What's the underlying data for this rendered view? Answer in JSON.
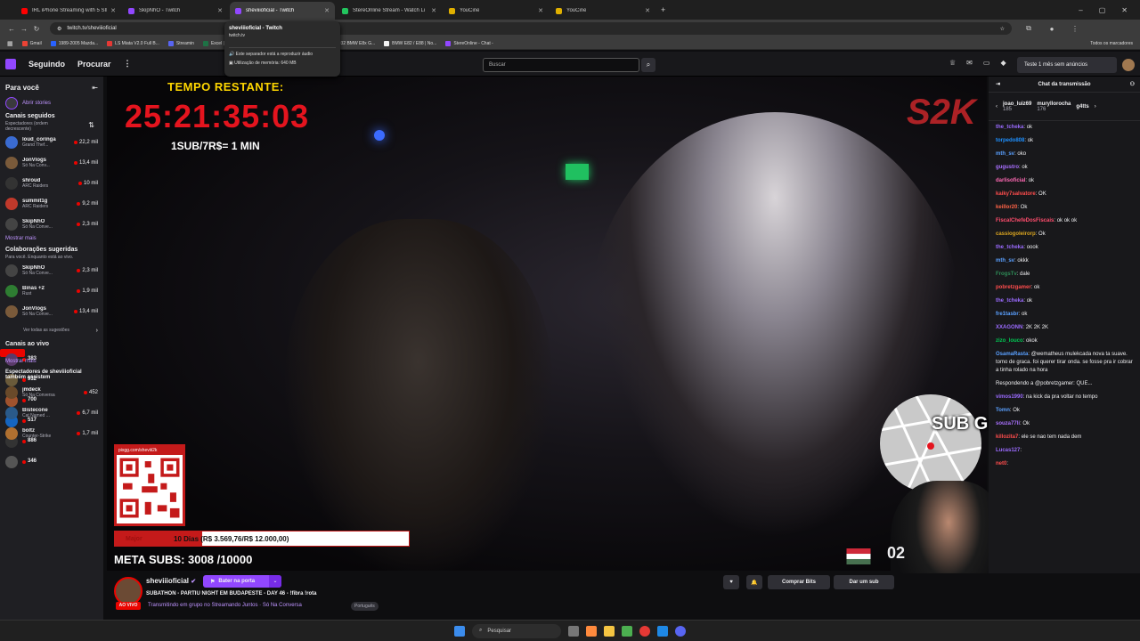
{
  "browser": {
    "tabs": [
      {
        "title": "IRL iPhone Streaming with 5 SIM",
        "color": "#ff0000",
        "active": false
      },
      {
        "title": "SkipNhO - Twitch",
        "color": "#9147ff",
        "active": false
      },
      {
        "title": "sheviiioficial - Twitch",
        "color": "#9147ff",
        "active": true
      },
      {
        "title": "StereOnline Stream - Watch Li",
        "color": "#22c55e",
        "active": false
      },
      {
        "title": "YouCine",
        "color": "#e0b000",
        "active": false
      },
      {
        "title": "YouCine",
        "color": "#e0b000",
        "active": false
      }
    ],
    "new_tab": "+",
    "url": "twitch.tv/sheviiioficial",
    "bookmarks": [
      "Gmail",
      "1989-2005 Mazda...",
      "LS Miata V2.0 Full B...",
      "Streamin",
      "Excel | Microsoft 365",
      "TopTierRamen and s...",
      "MFD32 BMW E8x G...",
      "BMW E82 / E88 | No...",
      "StereOnline - Chat -"
    ],
    "all_bookmarks": "Todos os marcadores",
    "tooltip": {
      "title": "sheviiioficial - Twitch",
      "domain": "twitch.tv",
      "audio": "Este separador está a reproduzir áudio",
      "memory": "Utilização de memória: 640 MB"
    }
  },
  "twitch_nav": {
    "following": "Seguindo",
    "browse": "Procurar",
    "search_placeholder": "Buscar",
    "turbo": "Teste 1 mês sem anúncios"
  },
  "sidebar": {
    "for_you": "Para você",
    "open_stories": "Abrir stories",
    "followed_title": "Canais seguidos",
    "followed_sort": "Espectadores (ordem decrescente)",
    "followed": [
      {
        "name": "loud_coringa",
        "game": "Grand Thef...",
        "viewers": "22,2 mil",
        "color": "#3a6bd1"
      },
      {
        "name": "JonVlogs",
        "game": "Só Na Conv...",
        "viewers": "13,4 mil",
        "color": "#7a5a3a"
      },
      {
        "name": "shroud",
        "game": "ARC Raiders",
        "viewers": "10 mil",
        "color": "#333"
      },
      {
        "name": "summit1g",
        "game": "ARC Raiders",
        "viewers": "9,2 mil",
        "color": "#c0392b"
      },
      {
        "name": "SkipNhO",
        "game": "Só Na Conve...",
        "viewers": "2,3 mil",
        "color": "#444"
      }
    ],
    "show_more": "Mostrar mais",
    "collab_title": "Colaborações sugeridas",
    "collab_sub": "Para você. Enquanto está ao vivo.",
    "collab": [
      {
        "name": "SkipNhO",
        "game": "Só Na Conve...",
        "viewers": "2,3 mil",
        "color": "#444"
      },
      {
        "name": "Binas +2",
        "game": "Rust",
        "viewers": "1,9 mil",
        "color": "#2e7d32"
      },
      {
        "name": "JonVlogs",
        "game": "Só Na Conve...",
        "viewers": "13,4 mil",
        "color": "#7a5a3a"
      }
    ],
    "see_all": "Ver todas as sugestões",
    "live_title": "Canais ao vivo",
    "live": [
      {
        "name": "vinixiste",
        "game": "Virtual Casino",
        "viewers": "383",
        "color": "#5a3a6a"
      },
      {
        "name": "thimagroo",
        "game": "Virtual Casino",
        "viewers": "932",
        "color": "#6a5a3a"
      },
      {
        "name": "euEllenmagnus",
        "game": "Só Na Conversa",
        "viewers": "700",
        "color": "#a0522d"
      },
      {
        "name": "ODUDUTIPS",
        "game": "IRL",
        "viewers": "517",
        "color": "#1565c0"
      },
      {
        "name": "Tecnosh",
        "game": "Virtual Casino",
        "viewers": "886",
        "color": "#333"
      },
      {
        "name": "StolenBR",
        "game": "Call of Duty: W...",
        "viewers": "346",
        "color": "#555"
      }
    ],
    "show_more2": "Mostrar mais",
    "also_title": "Espectadores de sheviiioficial também assistem",
    "also": [
      {
        "name": "jmdeck",
        "game": "Só Na Conversa",
        "viewers": "452",
        "color": "#6a4a2a"
      },
      {
        "name": "Bistecone",
        "game": "Cat Named ...",
        "viewers": "6,7 mil",
        "color": "#2a5a8a"
      },
      {
        "name": "boltz",
        "game": "Counter-Strike",
        "viewers": "1,7 mil",
        "color": "#b07030"
      }
    ]
  },
  "overlay": {
    "time_label": "TEMPO RESTANTE:",
    "timer": "25:21:35:03",
    "rate": "1SUB/7R$= 1 MIN",
    "qr_url": "pixgg.com/sheviii2k",
    "goal_left": "Major",
    "goal_text": "10 Dias (R$ 3.569,76/R$ 12.000,00)",
    "goal_progress": 0.297,
    "meta_subs": "META SUBS: 3008 /10000",
    "sub_goal": "SUB GOAL: 662/663",
    "logo": "S2K",
    "corner_num": "02"
  },
  "chat": {
    "header": "Chat da transmissão",
    "leaders": [
      {
        "name": "joao_luiz69",
        "count": "185"
      },
      {
        "name": "muryllorocha",
        "count": "176"
      },
      {
        "name": "g4tts",
        "count": ""
      }
    ],
    "messages": [
      {
        "user": "the_tcheka",
        "color": "#9b6bff",
        "text": "ok"
      },
      {
        "user": "torpedo808",
        "color": "#1e90ff",
        "text": "ok"
      },
      {
        "user": "mth_sv",
        "color": "#5aa0ff",
        "text": "oko"
      },
      {
        "user": "gugustro",
        "color": "#a970ff",
        "text": "ok"
      },
      {
        "user": "darlisoficial",
        "color": "#ff69b4",
        "text": "ok"
      },
      {
        "user": "kaiky7salvatore",
        "color": "#ff4d4d",
        "text": "OK"
      },
      {
        "user": "keillor20",
        "color": "#ff6347",
        "text": "Ok"
      },
      {
        "user": "FiscalChefeDosFiscais",
        "color": "#ff4d6d",
        "text": "ok ok ok"
      },
      {
        "user": "cassiogoleirorp",
        "color": "#daa520",
        "text": "Ok"
      },
      {
        "user": "the_tcheka",
        "color": "#9b6bff",
        "text": "oook"
      },
      {
        "user": "mth_sv",
        "color": "#5aa0ff",
        "text": "okkk"
      },
      {
        "user": "FrogsTv",
        "color": "#2e8b57",
        "text": "dale"
      },
      {
        "user": "pobretzgamer",
        "color": "#ff4d4d",
        "text": "ok"
      },
      {
        "user": "the_tcheka",
        "color": "#9b6bff",
        "text": "ok"
      },
      {
        "user": "fre1tasbr",
        "color": "#5aa0ff",
        "text": "ok"
      },
      {
        "user": "XXAGONN",
        "color": "#9b6bff",
        "text": "2K 2K 2K"
      },
      {
        "user": "zizo_louco",
        "color": "#00c853",
        "text": "okok"
      },
      {
        "user": "OsamaRasta",
        "color": "#5aa0ff",
        "text": "@wematheus mulekcada nova ta suave. tomo de graca. foi querer tirar onda. se fosse pra ir cobrar a tinha rolado na hora"
      },
      {
        "user": "",
        "color": "#adadb8",
        "text": "Respondendo a @pobretzgamer: QUE..."
      },
      {
        "user": "vimos1990",
        "color": "#9b6bff",
        "text": "na kick da pra voltar no tempo"
      },
      {
        "user": "Tomn",
        "color": "#5aa0ff",
        "text": "Ok"
      },
      {
        "user": "souza77li",
        "color": "#a970ff",
        "text": "Ok"
      },
      {
        "user": "killozita7",
        "color": "#ff4d4d",
        "text": "ele se nao tem nada dem"
      },
      {
        "user": "Lucas127",
        "color": "#9b6bff",
        "text": ""
      },
      {
        "user": "net0",
        "color": "#ff4d4d",
        "text": ""
      }
    ]
  },
  "stream_info": {
    "name": "sheviiioficial",
    "live": "AO VIVO",
    "knock": "Bater na porta",
    "title": "SUBATHON - PARTIU NIGHT EM BUDAPESTE - DAY 46 - !fibra !rota",
    "group": "Transmitindo em grupo no Streamando Juntos · Só Na Conversa",
    "language": "Português",
    "buy_bits": "Comprar Bits",
    "gift_sub": "Dar um sub"
  },
  "taskbar": {
    "search": "Pesquisar"
  }
}
